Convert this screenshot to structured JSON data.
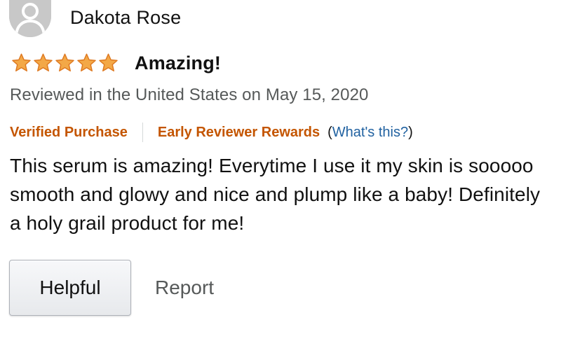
{
  "reviewer": {
    "name": "Dakota Rose",
    "avatar_icon": "default-user-avatar-icon"
  },
  "rating": {
    "stars": 5,
    "max_stars": 5,
    "star_color": "#f3a847",
    "title": "Amazing!"
  },
  "date_line": "Reviewed in the United States on May 15, 2020",
  "badges": {
    "verified": "Verified Purchase",
    "early_reviewer": "Early Reviewer Rewards",
    "whats_open": "(",
    "whats_link": "What's this?",
    "whats_close": ")"
  },
  "body": "This serum is amazing! Everytime I use it my skin is sooooo smooth and glowy and nice and plump like a baby! Definitely a holy grail product for me!",
  "actions": {
    "helpful": "Helpful",
    "report": "Report"
  },
  "colors": {
    "badge_orange": "#c45500",
    "link_blue": "#2162a1",
    "muted_gray": "#565959"
  }
}
